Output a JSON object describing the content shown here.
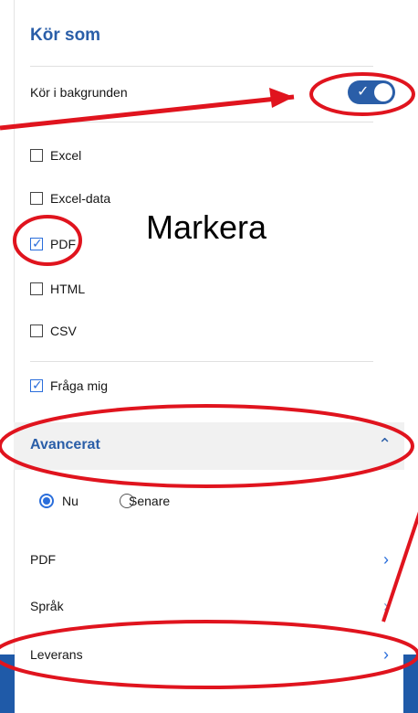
{
  "header": {
    "title": "Kör som"
  },
  "background": {
    "label": "Kör i bakgrunden",
    "toggle_on": true
  },
  "formats": [
    {
      "label": "Excel",
      "checked": false
    },
    {
      "label": "Excel-data",
      "checked": false
    },
    {
      "label": "PDF",
      "checked": true
    },
    {
      "label": "HTML",
      "checked": false
    },
    {
      "label": "CSV",
      "checked": false
    }
  ],
  "ask_me": {
    "label": "Fråga mig",
    "checked": true
  },
  "advanced": {
    "title": "Avancerat",
    "expanded": true
  },
  "timing": {
    "now_label": "Nu",
    "later_label": "Senare",
    "selected": "Nu"
  },
  "nav": [
    {
      "label": "PDF"
    },
    {
      "label": "Språk"
    },
    {
      "label": "Leverans"
    }
  ],
  "annotation": {
    "text": "Markera"
  },
  "colors": {
    "accent": "#2a5ea8",
    "check": "#2a6edb",
    "annotation": "#e0141e"
  }
}
